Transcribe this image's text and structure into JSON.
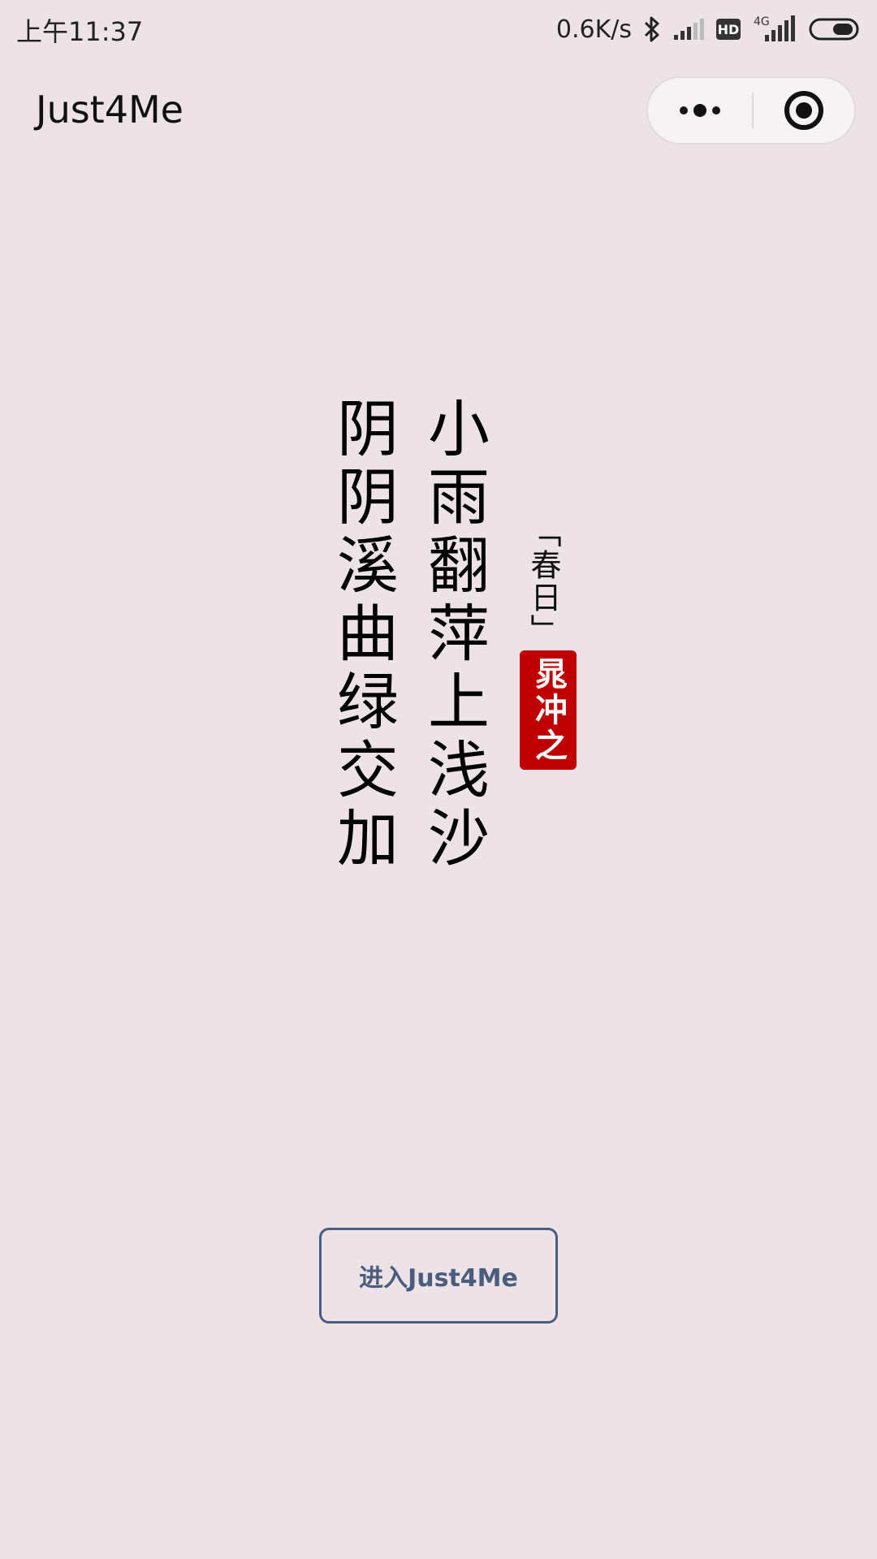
{
  "status_bar": {
    "time": "上午11:37",
    "net_speed": "0.6K/s",
    "hd_badge": "HD",
    "network_type": "4G"
  },
  "nav": {
    "title": "Just4Me"
  },
  "poem": {
    "lines": [
      "小雨翻萍上浅沙",
      "阴阴溪曲绿交加"
    ],
    "title": "「春日」",
    "author": "晁冲之"
  },
  "enter_button": {
    "label": "进入Just4Me"
  },
  "colors": {
    "background": "#ede3e7",
    "seal": "#c00000",
    "button_accent": "#4a5d7e"
  }
}
